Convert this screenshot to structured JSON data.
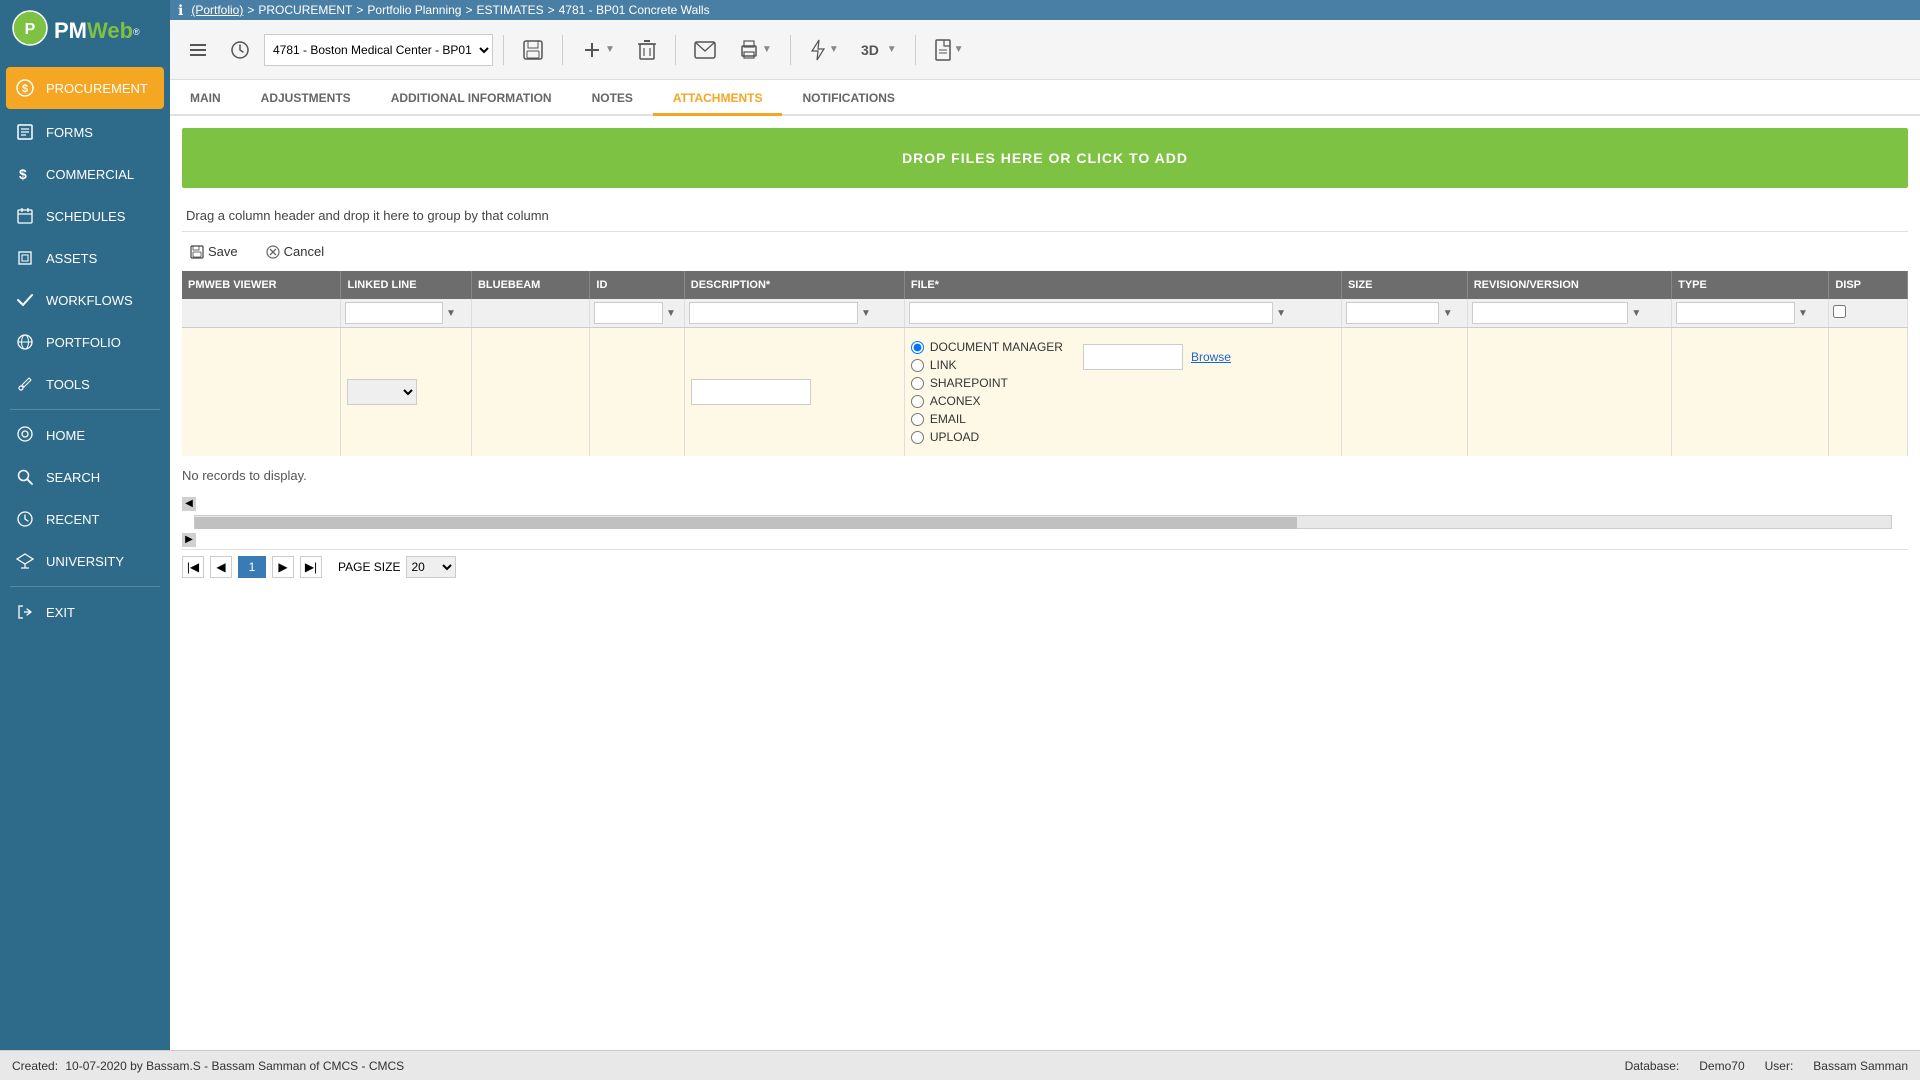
{
  "logo": {
    "pm": "PM",
    "web": "Web",
    "trademark": "®"
  },
  "sidebar": {
    "active_item": "PROCUREMENT",
    "items": [
      {
        "id": "procurement",
        "label": "PROCUREMENT",
        "icon": "dollar"
      },
      {
        "id": "forms",
        "label": "FORMS",
        "icon": "form"
      },
      {
        "id": "commercial",
        "label": "COMMERCIAL",
        "icon": "dollar-sign"
      },
      {
        "id": "schedules",
        "label": "SCHEDULES",
        "icon": "calendar"
      },
      {
        "id": "assets",
        "label": "ASSETS",
        "icon": "cube"
      },
      {
        "id": "workflows",
        "label": "WORKFLOWS",
        "icon": "check"
      },
      {
        "id": "portfolio",
        "label": "PORTFOLIO",
        "icon": "globe"
      },
      {
        "id": "tools",
        "label": "TOOLS",
        "icon": "wrench"
      },
      {
        "id": "home",
        "label": "HOME",
        "icon": "home"
      },
      {
        "id": "search",
        "label": "SEARCH",
        "icon": "search"
      },
      {
        "id": "recent",
        "label": "RECENT",
        "icon": "clock"
      },
      {
        "id": "university",
        "label": "UNIVERSITY",
        "icon": "graduation"
      },
      {
        "id": "exit",
        "label": "EXIT",
        "icon": "exit"
      }
    ]
  },
  "breadcrumb": {
    "info_icon": "ℹ",
    "parts": [
      "(Portfolio)",
      ">",
      "PROCUREMENT",
      ">",
      "Portfolio Planning",
      ">",
      "ESTIMATES",
      ">",
      "4781 - BP01 Concrete Walls"
    ]
  },
  "toolbar": {
    "record_select": "4781 - Boston Medical Center - BP01",
    "buttons": [
      "menu",
      "history",
      "save",
      "add",
      "delete",
      "email",
      "print",
      "lightning",
      "3d",
      "document"
    ]
  },
  "tabs": [
    {
      "id": "main",
      "label": "MAIN"
    },
    {
      "id": "adjustments",
      "label": "ADJUSTMENTS"
    },
    {
      "id": "additional",
      "label": "ADDITIONAL INFORMATION"
    },
    {
      "id": "notes",
      "label": "NOTES"
    },
    {
      "id": "attachments",
      "label": "ATTACHMENTS",
      "active": true
    },
    {
      "id": "notifications",
      "label": "NOTIFICATIONS"
    }
  ],
  "drop_zone": {
    "text": "DROP FILES HERE OR CLICK TO ADD"
  },
  "drag_hint": "Drag a column header and drop it here to group by that column",
  "action_bar": {
    "save_label": "Save",
    "cancel_label": "Cancel"
  },
  "table": {
    "columns": [
      {
        "id": "pmweb",
        "label": "PMWEB VIEWER"
      },
      {
        "id": "linked",
        "label": "LINKED LINE"
      },
      {
        "id": "bluebeam",
        "label": "BLUEBEAM"
      },
      {
        "id": "id",
        "label": "ID"
      },
      {
        "id": "description",
        "label": "DESCRIPTION*"
      },
      {
        "id": "file",
        "label": "FILE*"
      },
      {
        "id": "size",
        "label": "SIZE"
      },
      {
        "id": "revision",
        "label": "REVISION/VERSION"
      },
      {
        "id": "type",
        "label": "TYPE"
      },
      {
        "id": "disp",
        "label": "DISP"
      }
    ]
  },
  "add_row": {
    "radio_options": [
      {
        "id": "document_manager",
        "label": "DOCUMENT MANAGER",
        "checked": true
      },
      {
        "id": "link",
        "label": "LINK",
        "checked": false
      },
      {
        "id": "sharepoint",
        "label": "SHAREPOINT",
        "checked": false
      },
      {
        "id": "aconex",
        "label": "ACONEX",
        "checked": false
      },
      {
        "id": "email",
        "label": "EMAIL",
        "checked": false
      },
      {
        "id": "upload",
        "label": "UPLOAD",
        "checked": false
      }
    ],
    "browse_label": "Browse"
  },
  "no_records": "No records to display.",
  "pagination": {
    "current_page": "1",
    "page_size": "20",
    "page_size_label": "PAGE SIZE"
  },
  "statusbar": {
    "created_label": "Created:",
    "created_value": "10-07-2020 by Bassam.S - Bassam Samman of CMCS - CMCS",
    "database_label": "Database:",
    "database_value": "Demo70",
    "user_label": "User:",
    "user_value": "Bassam Samman"
  }
}
